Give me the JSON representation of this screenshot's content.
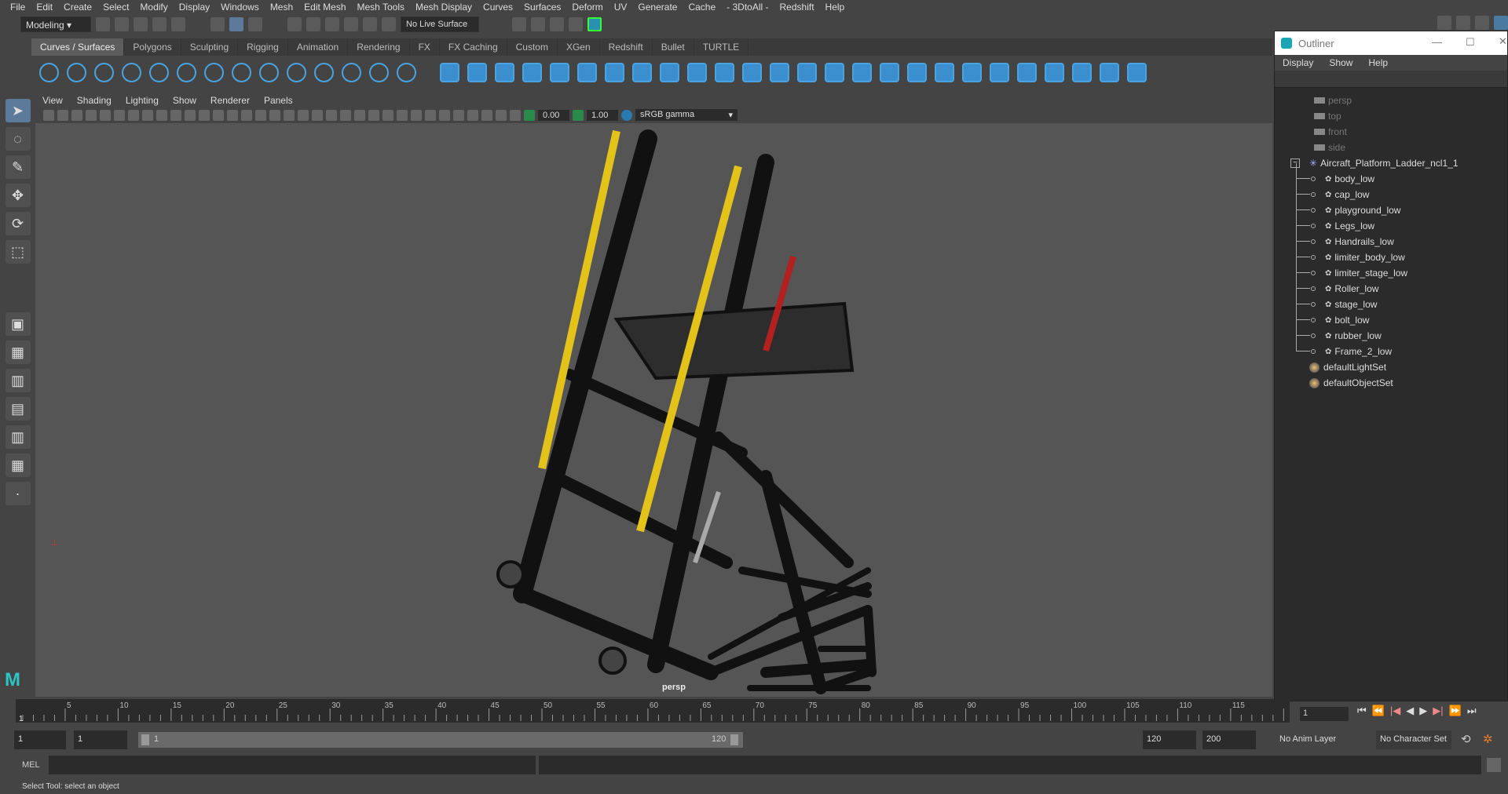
{
  "menubar": [
    "File",
    "Edit",
    "Create",
    "Select",
    "Modify",
    "Display",
    "Windows",
    "Mesh",
    "Edit Mesh",
    "Mesh Tools",
    "Mesh Display",
    "Curves",
    "Surfaces",
    "Deform",
    "UV",
    "Generate",
    "Cache",
    "- 3DtoAll -",
    "Redshift",
    "Help"
  ],
  "toolbar": {
    "mode": "Modeling",
    "live_surface": "No Live Surface"
  },
  "shelf_tabs": [
    "Curves / Surfaces",
    "Polygons",
    "Sculpting",
    "Rigging",
    "Animation",
    "Rendering",
    "FX",
    "FX Caching",
    "Custom",
    "XGen",
    "Redshift",
    "Bullet",
    "TURTLE"
  ],
  "shelf_active": "Curves / Surfaces",
  "shelf_icons": [
    "nurbs-circle",
    "nurbs-square",
    "ep-curve",
    "pencil-curve",
    "bezier-curve",
    "arc",
    "curve-intersect",
    "attach-curve",
    "detach-curve",
    "rebuild-curve",
    "offset-curve",
    "fillet-curve",
    "extend-curve",
    "project-curve",
    "nurbs-sphere",
    "nurbs-cube",
    "nurbs-cylinder",
    "nurbs-cone",
    "nurbs-plane",
    "nurbs-torus",
    "revolve",
    "loft",
    "planar",
    "extrude",
    "birail",
    "boundary",
    "square-surface",
    "bevel",
    "trim",
    "untrim",
    "intersect",
    "project-on-surface",
    "attach-surface",
    "detach-surface",
    "align-surface",
    "open-close",
    "insert-isoparm",
    "rebuild-surface",
    "sculpt-surface",
    "nurbs-to-poly"
  ],
  "panel_menu": [
    "View",
    "Shading",
    "Lighting",
    "Show",
    "Renderer",
    "Panels"
  ],
  "viewport_toolbar": {
    "exposure": "0.00",
    "gamma": "1.00",
    "color_space": "sRGB gamma"
  },
  "viewport": {
    "camera_label": "persp",
    "accent_yellow": "#e3c21a"
  },
  "outliner": {
    "title": "Outliner",
    "menu": [
      "Display",
      "Show",
      "Help"
    ],
    "cameras": [
      "persp",
      "top",
      "front",
      "side"
    ],
    "group": "Aircraft_Platform_Ladder_ncl1_1",
    "children": [
      "body_low",
      "cap_low",
      "playground_low",
      "Legs_low",
      "Handrails_low",
      "limiter_body_low",
      "limiter_stage_low",
      "Roller_low",
      "stage_low",
      "bolt_low",
      "rubber_low",
      "Frame_2_low"
    ],
    "sets": [
      "defaultLightSet",
      "defaultObjectSet"
    ]
  },
  "timeline": {
    "labels": [
      "5",
      "10",
      "15",
      "20",
      "25",
      "30",
      "35",
      "40",
      "45",
      "50",
      "55",
      "60",
      "65",
      "70",
      "75",
      "80",
      "85",
      "90",
      "95",
      "100",
      "105",
      "110",
      "115"
    ],
    "current_frame": "1",
    "current_frame_field": "1"
  },
  "range": {
    "start": "1",
    "playback_start": "1",
    "slider_start": "1",
    "slider_end": "120",
    "playback_end": "120",
    "end": "200",
    "anim_layer": "No Anim Layer",
    "character_set": "No Character Set"
  },
  "mel": {
    "label": "MEL"
  },
  "status": "Select Tool: select an object"
}
